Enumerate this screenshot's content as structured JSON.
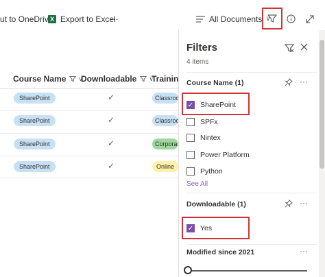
{
  "toolbar": {
    "onedrive_label": "ut to OneDrive",
    "export_label": "Export to Excel",
    "excel_glyph": "X",
    "more_label": "···",
    "view_label": "All Documents",
    "view_chevron": "∨",
    "filter_icon": "filter-icon",
    "info_icon": "info-icon",
    "expand_icon": "expand-icon"
  },
  "columns": {
    "course_name": "Course Name",
    "downloadable": "Downloadable",
    "training": "Training U"
  },
  "rows": [
    {
      "course": "SharePoint",
      "downloadable": "✓",
      "training": "Classroo",
      "training_color": "#c7e0f4"
    },
    {
      "course": "SharePoint",
      "downloadable": "✓",
      "training": "Classroo",
      "training_color": "#c7e0f4"
    },
    {
      "course": "SharePoint",
      "downloadable": "✓",
      "training": "Corpora",
      "training_color": "#9fd89f"
    },
    {
      "course": "SharePoint",
      "downloadable": "✓",
      "training": "Online",
      "training_color": "#fff1a8"
    }
  ],
  "filters": {
    "title": "Filters",
    "count": "4 items",
    "clear_icon": "clear-filter-icon",
    "close_icon": "close-icon",
    "course_section": {
      "title": "Course Name (1)",
      "options": [
        {
          "label": "SharePoint",
          "checked": true
        },
        {
          "label": "SPFx",
          "checked": false
        },
        {
          "label": "Nintex",
          "checked": false
        },
        {
          "label": "Power Platform",
          "checked": false
        },
        {
          "label": "Python",
          "checked": false
        }
      ],
      "see_all": "See All"
    },
    "downloadable_section": {
      "title": "Downloadable (1)",
      "options": [
        {
          "label": "Yes",
          "checked": true
        }
      ]
    },
    "modified_section": {
      "title": "Modified since 2021"
    },
    "more_label": "···",
    "pin_icon": "pin-icon"
  },
  "colors": {
    "accent": "#7b4fa8",
    "highlight_border": "#d13438",
    "sharepoint_pill": "#c7e0f4"
  }
}
